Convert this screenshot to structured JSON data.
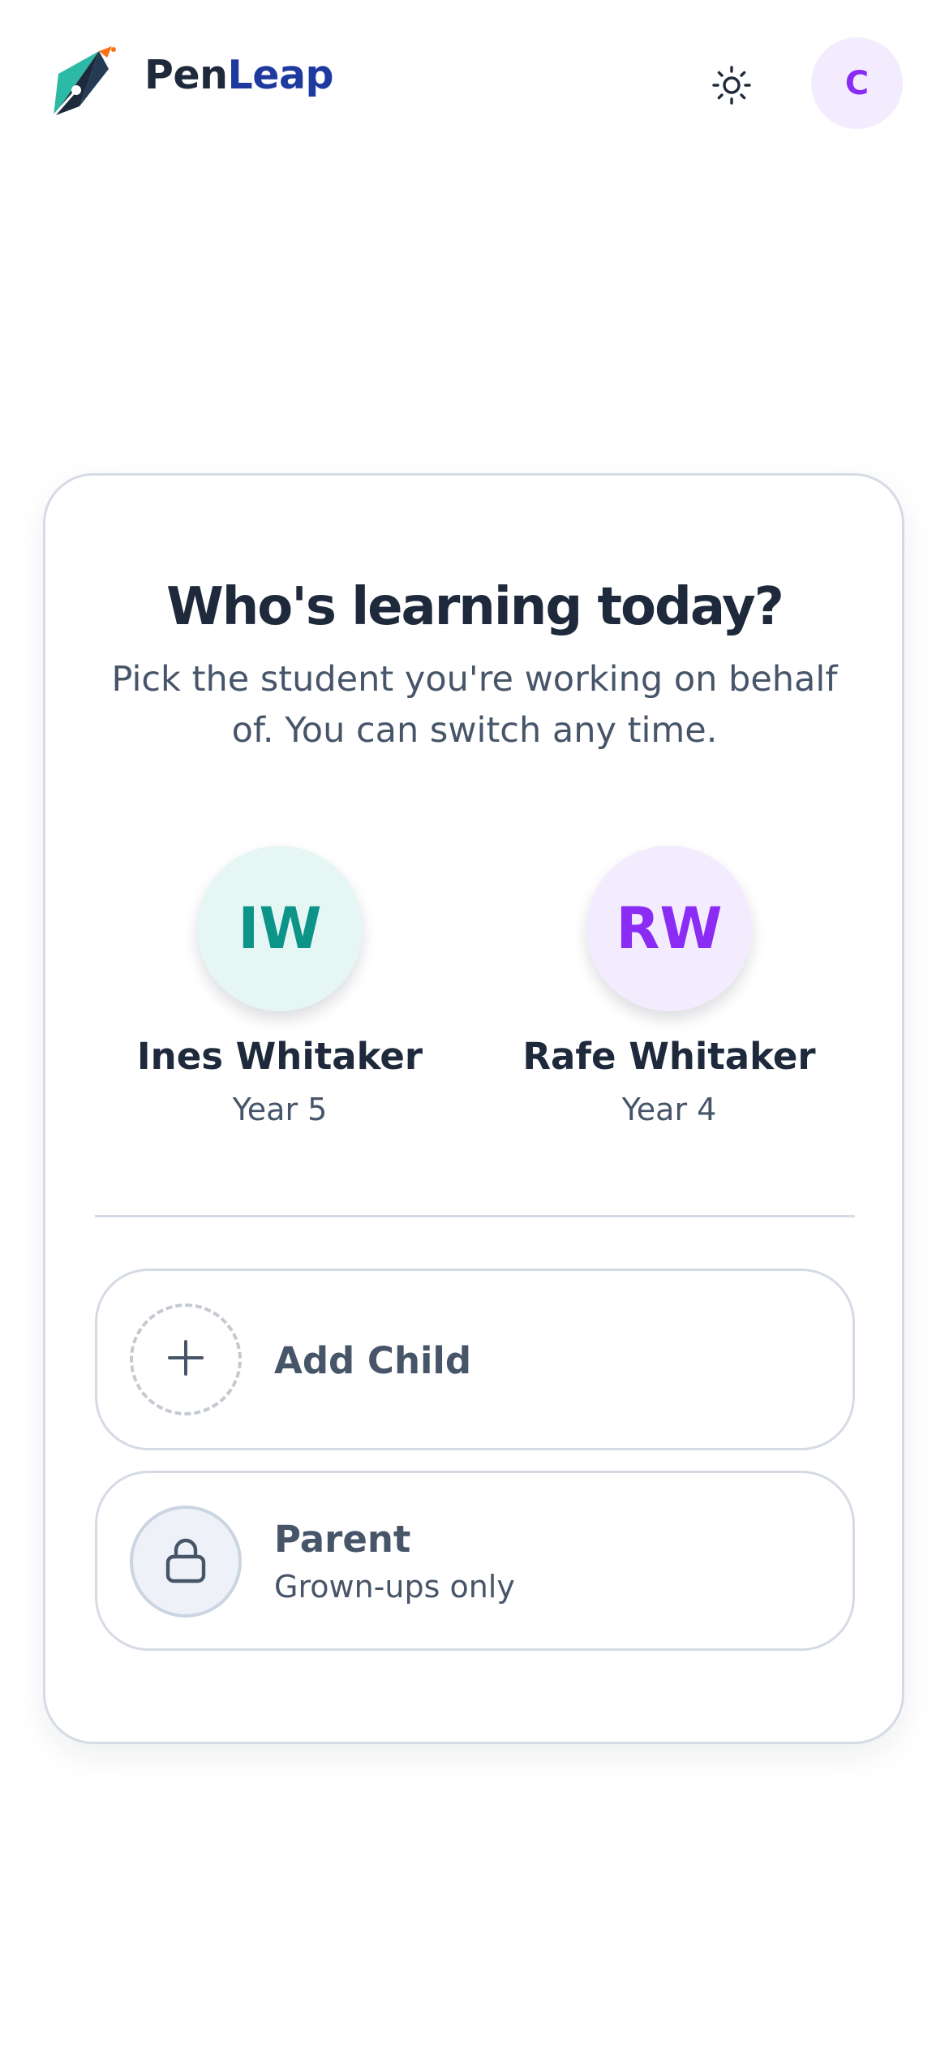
{
  "header": {
    "brand_part1": "Pen",
    "brand_part2": "Leap",
    "account_initial": "C"
  },
  "picker": {
    "title": "Who's learning today?",
    "subtitle": "Pick the student you're working on behalf of. You can switch any time."
  },
  "students": [
    {
      "initials": "IW",
      "name": "Ines Whitaker",
      "grade": "Year 5",
      "color": "#0d9488",
      "bg": "#e6f6f4"
    },
    {
      "initials": "RW",
      "name": "Rafe Whitaker",
      "grade": "Year 4",
      "color": "#8b2cf5",
      "bg": "#f3ecfe"
    }
  ],
  "actions": {
    "add_child_label": "Add Child",
    "parent_label": "Parent",
    "parent_sub": "Grown-ups only"
  },
  "icons": {
    "theme": "sun-icon",
    "add": "plus-icon",
    "parent": "lock-icon",
    "logo": "pen-nib-logo"
  },
  "colors": {
    "brand_dark": "#1e293b",
    "brand_accent": "#1e3a9f",
    "account_accent": "#8b2cf5",
    "border": "#d5dbe5"
  }
}
